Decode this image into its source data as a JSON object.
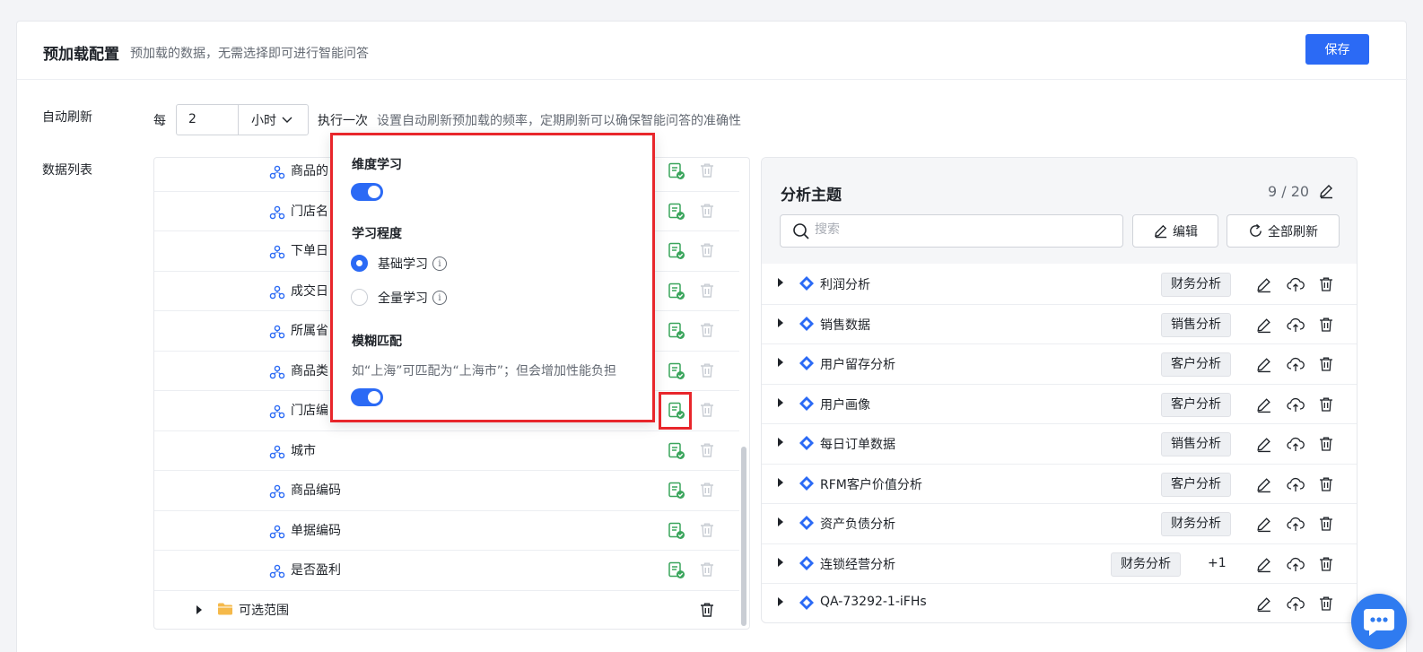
{
  "header": {
    "title": "预加载配置",
    "subtitle": "预加载的数据，无需选择即可进行智能问答",
    "save_label": "保存"
  },
  "refresh": {
    "label": "自动刷新",
    "every": "每",
    "value": "2",
    "unit": "小时",
    "exec": "执行一次",
    "hint": "设置自动刷新预加载的频率，定期刷新可以确保智能问答的准确性"
  },
  "data_list": {
    "label": "数据列表",
    "rows": [
      {
        "name": "商品的"
      },
      {
        "name": "门店名"
      },
      {
        "name": "下单日"
      },
      {
        "name": "成交日"
      },
      {
        "name": "所属省"
      },
      {
        "name": "商品类"
      },
      {
        "name": "门店编"
      },
      {
        "name": "城市"
      },
      {
        "name": "商品编码"
      },
      {
        "name": "单据编码"
      },
      {
        "name": "是否盈利"
      }
    ],
    "folder": "可选范围"
  },
  "popup": {
    "dim_learning": "维度学习",
    "level_title": "学习程度",
    "options": [
      "基础学习",
      "全量学习"
    ],
    "selected": "基础学习",
    "fuzzy_title": "模糊匹配",
    "fuzzy_desc": "如“上海”可匹配为“上海市”；但会增加性能负担",
    "info_glyph": "i"
  },
  "topics": {
    "title": "分析主题",
    "count": "9 / 20",
    "search_placeholder": "搜索",
    "edit_label": "编辑",
    "refresh_all_label": "全部刷新",
    "items": [
      {
        "name": "利润分析",
        "tag": "财务分析"
      },
      {
        "name": "销售数据",
        "tag": "销售分析"
      },
      {
        "name": "用户留存分析",
        "tag": "客户分析"
      },
      {
        "name": "用户画像",
        "tag": "客户分析"
      },
      {
        "name": "每日订单数据",
        "tag": "销售分析"
      },
      {
        "name": "RFM客户价值分析",
        "tag": "客户分析"
      },
      {
        "name": "资产负债分析",
        "tag": "财务分析"
      },
      {
        "name": "连锁经营分析",
        "tag": "财务分析",
        "extra": "+1"
      },
      {
        "name": "QA-73292-1-iFHs",
        "tag": ""
      }
    ]
  },
  "colors": {
    "accent": "#2b6af5",
    "highlight": "#e8262b",
    "learn_icon": "#3aa55c"
  }
}
